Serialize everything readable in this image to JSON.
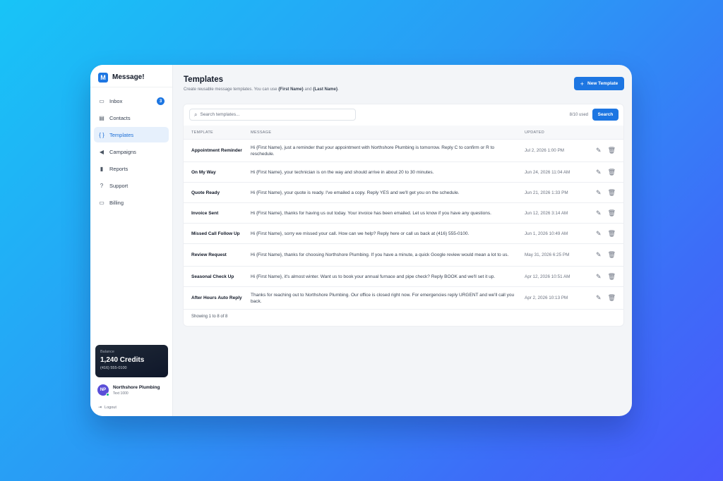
{
  "brand": {
    "logo": "M",
    "name": "Message!"
  },
  "nav": [
    {
      "label": "Inbox",
      "icon": "inbox-icon",
      "glyph": "▭",
      "badge": "3"
    },
    {
      "label": "Contacts",
      "icon": "contacts-icon",
      "glyph": "▤"
    },
    {
      "label": "Templates",
      "icon": "braces-icon",
      "glyph": "{ }",
      "active": true
    },
    {
      "label": "Campaigns",
      "icon": "megaphone-icon",
      "glyph": "◀"
    },
    {
      "label": "Reports",
      "icon": "bar-chart-icon",
      "glyph": "▮"
    },
    {
      "label": "Support",
      "icon": "help-icon",
      "glyph": "?"
    },
    {
      "label": "Billing",
      "icon": "credit-card-icon",
      "glyph": "▭"
    }
  ],
  "balance": {
    "label": "Balance",
    "value": "1,240 Credits",
    "phone": "(416) 555-0100"
  },
  "account": {
    "initials": "NP",
    "name": "Northshore Plumbing",
    "plan": "Text 1000"
  },
  "logout": {
    "label": "Logout"
  },
  "header": {
    "title": "Templates",
    "subtitle_pre": "Create reusable message templates. You can use ",
    "subtitle_first": "{First Name}",
    "subtitle_mid": " and ",
    "subtitle_last": "{Last Name}",
    "subtitle_end": ".",
    "new_button": "New Template"
  },
  "toolbar": {
    "search_placeholder": "Search templates...",
    "usage": "8/10 used",
    "search_button": "Search"
  },
  "table": {
    "columns": {
      "template": "TEMPLATE",
      "message": "MESSAGE",
      "updated": "UPDATED"
    },
    "rows": [
      {
        "name": "Appointment Reminder",
        "message": "Hi {First Name}, just a reminder that your appointment with Northshore Plumbing is tomorrow. Reply C to confirm or R to reschedule.",
        "updated": "Jul 2, 2026 1:00 PM"
      },
      {
        "name": "On My Way",
        "message": "Hi {First Name}, your technician is on the way and should arrive in about 20 to 30 minutes.",
        "updated": "Jun 24, 2026 11:04 AM"
      },
      {
        "name": "Quote Ready",
        "message": "Hi {First Name}, your quote is ready. I've emailed a copy. Reply YES and we'll get you on the schedule.",
        "updated": "Jun 21, 2026 1:33 PM"
      },
      {
        "name": "Invoice Sent",
        "message": "Hi {First Name}, thanks for having us out today. Your invoice has been emailed. Let us know if you have any questions.",
        "updated": "Jun 12, 2026 3:14 AM"
      },
      {
        "name": "Missed Call Follow Up",
        "message": "Hi {First Name}, sorry we missed your call. How can we help? Reply here or call us back at (416) 555-0100.",
        "updated": "Jun 1, 2026 10:49 AM"
      },
      {
        "name": "Review Request",
        "message": "Hi {First Name}, thanks for choosing Northshore Plumbing. If you have a minute, a quick Google review would mean a lot to us.",
        "updated": "May 31, 2026 6:25 PM"
      },
      {
        "name": "Seasonal Check Up",
        "message": "Hi {First Name}, it's almost winter. Want us to book your annual furnace and pipe check? Reply BOOK and we'll set it up.",
        "updated": "Apr 12, 2026 10:51 AM"
      },
      {
        "name": "After Hours Auto Reply",
        "message": "Thanks for reaching out to Northshore Plumbing. Our office is closed right now. For emergencies reply URGENT and we'll call you back.",
        "updated": "Apr 2, 2026 10:13 PM"
      }
    ],
    "footer": "Showing 1 to 8 of 8"
  }
}
